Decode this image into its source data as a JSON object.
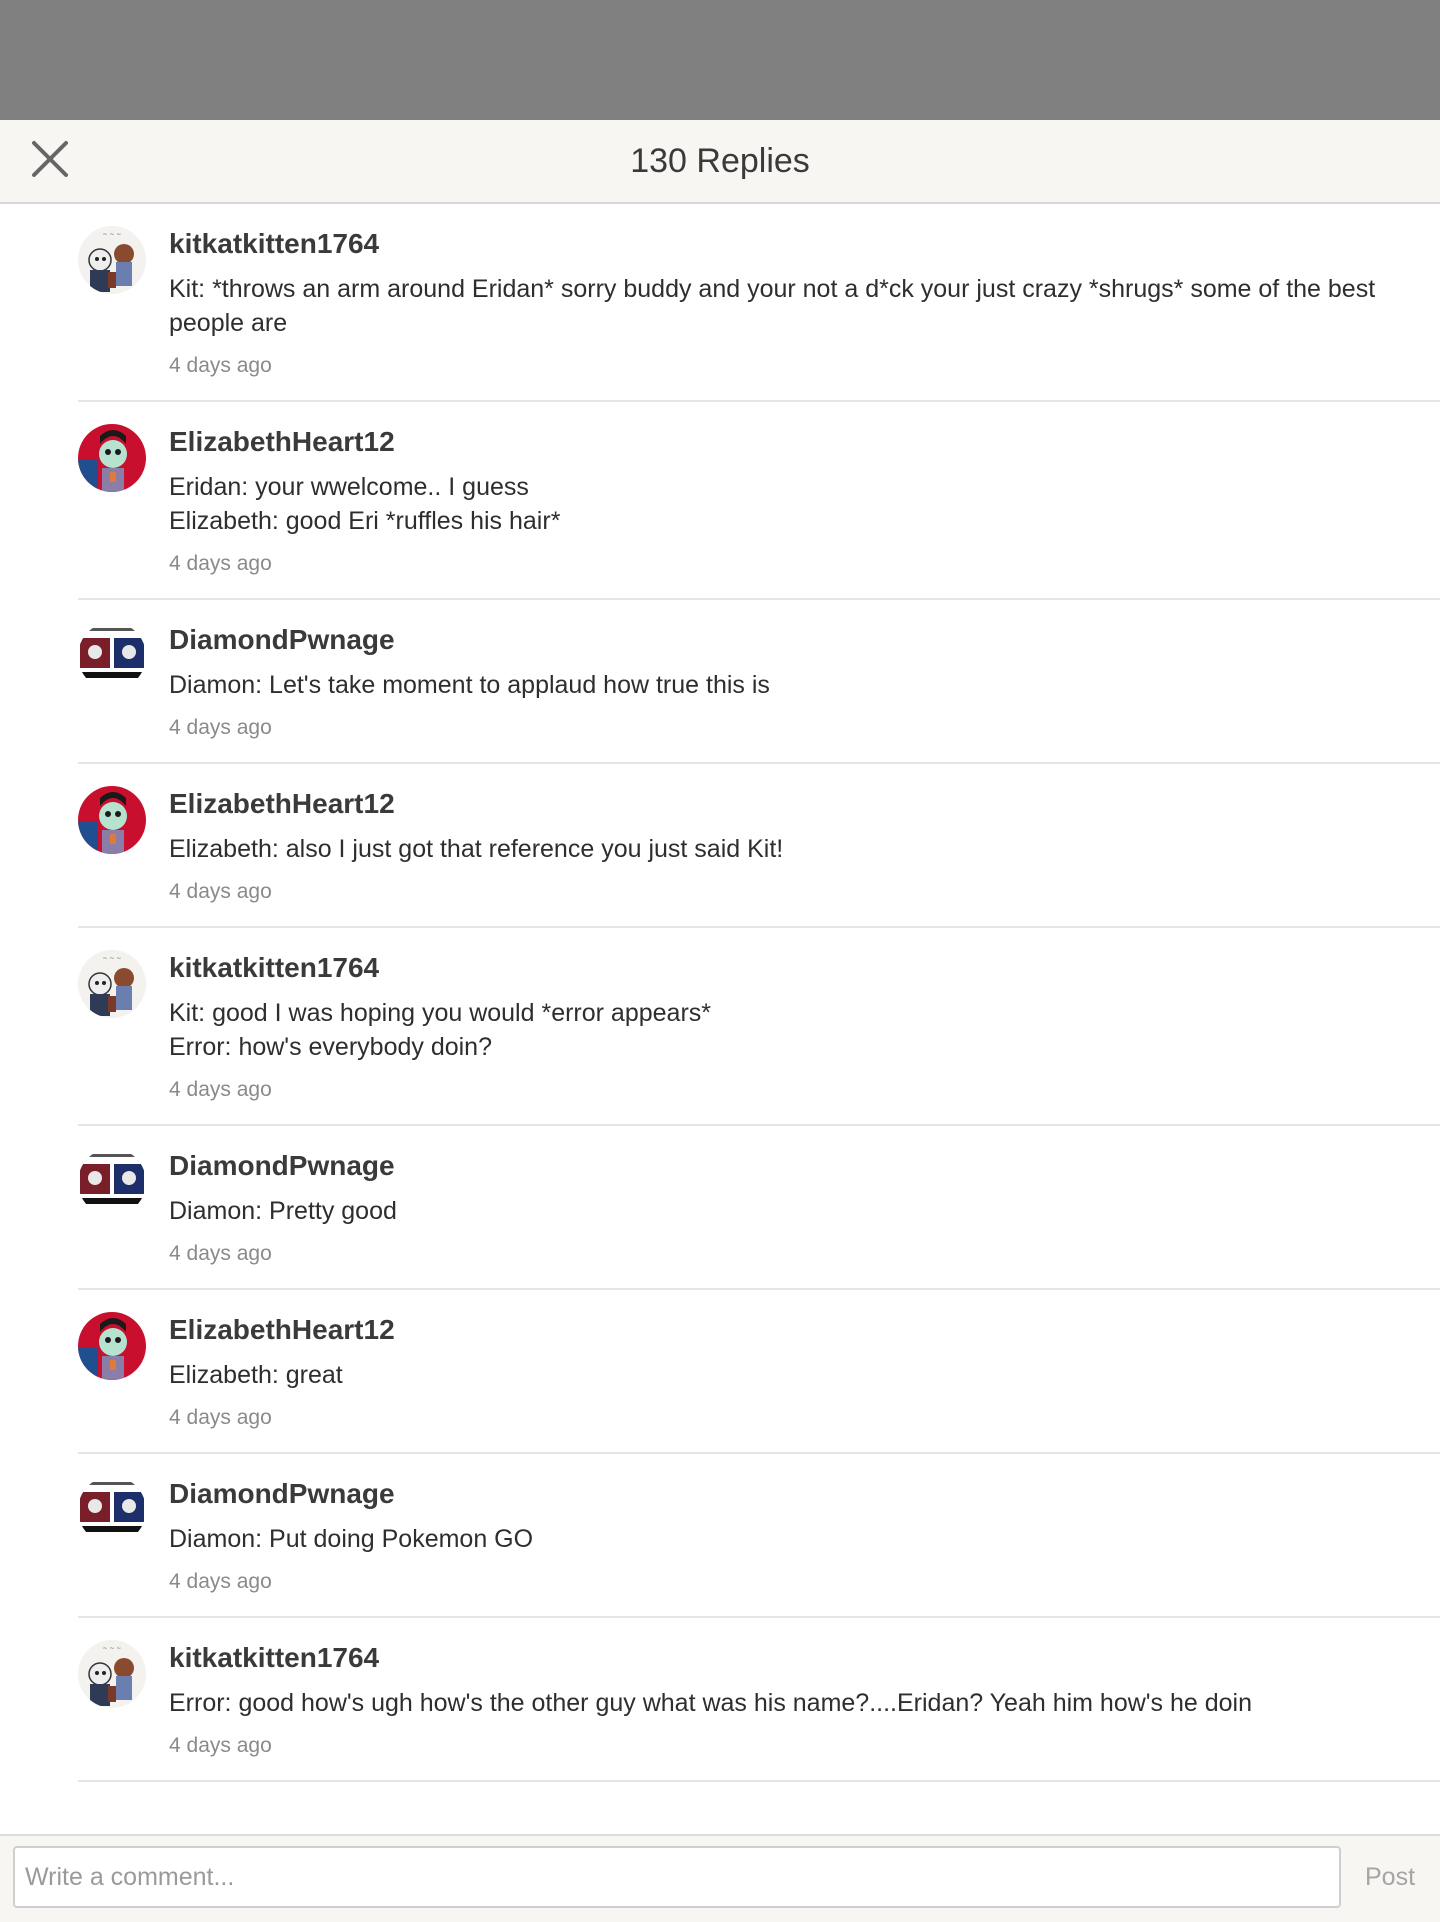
{
  "header": {
    "title": "130 Replies",
    "close_icon": "close-icon"
  },
  "replies": [
    {
      "username": "kitkatkitten1764",
      "avatar": "avatar-kit",
      "lines": [
        "Kit: *throws an arm around Eridan* sorry buddy and your not a d*ck your just crazy *shrugs* some of the best",
        "people are"
      ],
      "time": "4 days ago"
    },
    {
      "username": "ElizabethHeart12",
      "avatar": "avatar-elizabeth",
      "lines": [
        "Eridan: your wwelcome.. I guess",
        "Elizabeth: good Eri *ruffles his hair*"
      ],
      "time": "4 days ago"
    },
    {
      "username": "DiamondPwnage",
      "avatar": "avatar-diamond",
      "lines": [
        "Diamon: Let's take moment to applaud how true this is"
      ],
      "time": "4 days ago"
    },
    {
      "username": "ElizabethHeart12",
      "avatar": "avatar-elizabeth",
      "lines": [
        "Elizabeth: also I just got that reference you just said Kit!"
      ],
      "time": "4 days ago"
    },
    {
      "username": "kitkatkitten1764",
      "avatar": "avatar-kit",
      "lines": [
        "Kit: good I was hoping you would *error appears*",
        "Error: how's everybody doin?"
      ],
      "time": "4 days ago"
    },
    {
      "username": "DiamondPwnage",
      "avatar": "avatar-diamond",
      "lines": [
        "Diamon: Pretty good"
      ],
      "time": "4 days ago"
    },
    {
      "username": "ElizabethHeart12",
      "avatar": "avatar-elizabeth",
      "lines": [
        "Elizabeth: great"
      ],
      "time": "4 days ago"
    },
    {
      "username": "DiamondPwnage",
      "avatar": "avatar-diamond",
      "lines": [
        "Diamon: Put doing Pokemon GO"
      ],
      "time": "4 days ago"
    },
    {
      "username": "kitkatkitten1764",
      "avatar": "avatar-kit",
      "lines": [
        "Error: good how's ugh how's the other guy what was his name?....Eridan? Yeah him how's he doin"
      ],
      "time": "4 days ago"
    }
  ],
  "composer": {
    "placeholder": "Write a comment...",
    "value": "",
    "post_label": "Post"
  },
  "colors": {
    "topbar": "#808080",
    "header_bg": "#f7f6f2",
    "username": "#3a3a3a",
    "timestamp": "#8a8a8a",
    "post_disabled": "#a5a5a5"
  }
}
